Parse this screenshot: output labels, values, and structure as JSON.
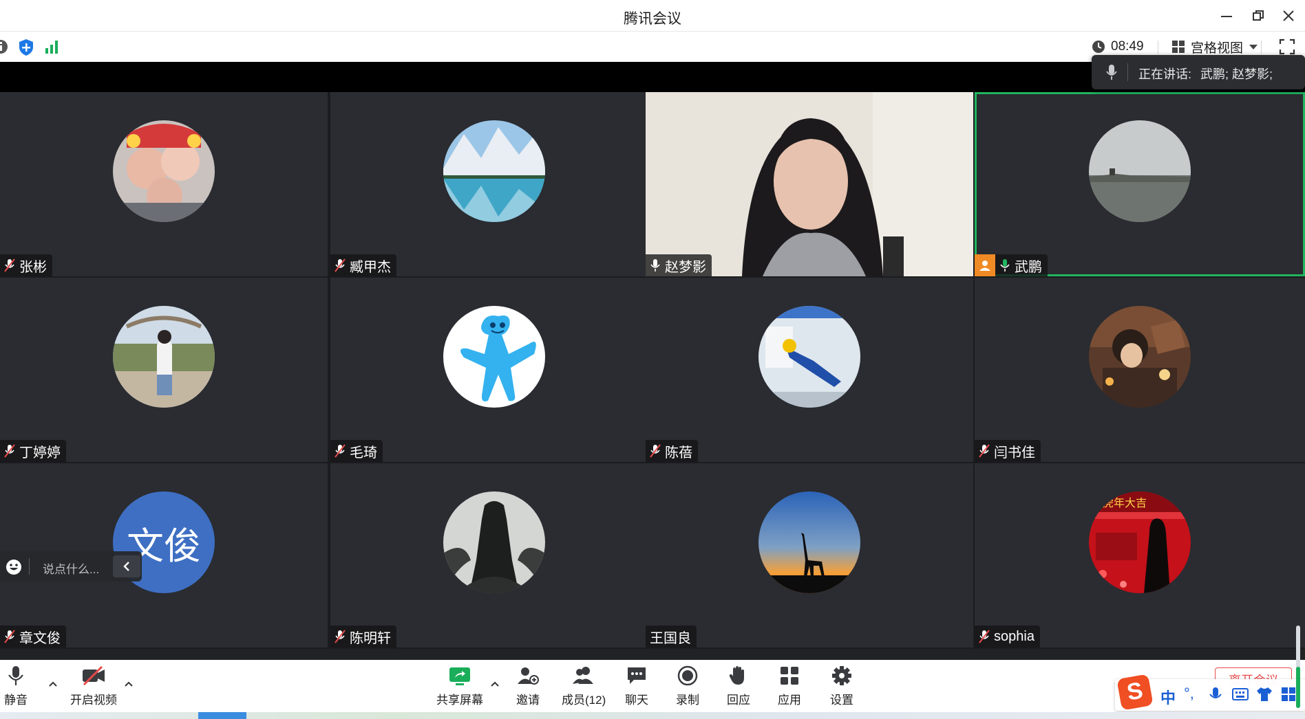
{
  "window": {
    "title": "腾讯会议"
  },
  "infobar": {
    "timer": "08:49",
    "view_mode": "宫格视图"
  },
  "speaking": {
    "label": "正在讲话:",
    "names": "武鹏; 赵梦影;"
  },
  "participants": [
    {
      "name": "张彬",
      "mic": "off"
    },
    {
      "name": "臧甲杰",
      "mic": "off"
    },
    {
      "name": "赵梦影",
      "mic": "on"
    },
    {
      "name": "武鹏",
      "mic": "speaking"
    },
    {
      "name": "丁婷婷",
      "mic": "off"
    },
    {
      "name": "毛琦",
      "mic": "off"
    },
    {
      "name": "陈蓓",
      "mic": "off"
    },
    {
      "name": "闫书佳",
      "mic": "off"
    },
    {
      "name": "章文俊",
      "mic": "off"
    },
    {
      "name": "陈明轩",
      "mic": "off"
    },
    {
      "name": "王国良",
      "mic": "none"
    },
    {
      "name": "sophia",
      "mic": "off"
    }
  ],
  "avatar_text": {
    "zhang_wenjun": "文俊"
  },
  "chat": {
    "placeholder": "说点什么..."
  },
  "toolbar": {
    "mute": "静音",
    "video": "开启视频",
    "share": "共享屏幕",
    "invite": "邀请",
    "members": "成员(12)",
    "chat": "聊天",
    "record": "录制",
    "react": "回应",
    "apps": "应用",
    "settings": "设置",
    "leave": "离开会议"
  },
  "ime": {
    "mode": "中",
    "punct": "°,"
  },
  "colors": {
    "active_border": "#21b55f",
    "host_badge": "#f08a24",
    "share_green": "#1aad5a",
    "leave_red": "#e84b4b",
    "avatar_blue": "#3e6fc3"
  }
}
